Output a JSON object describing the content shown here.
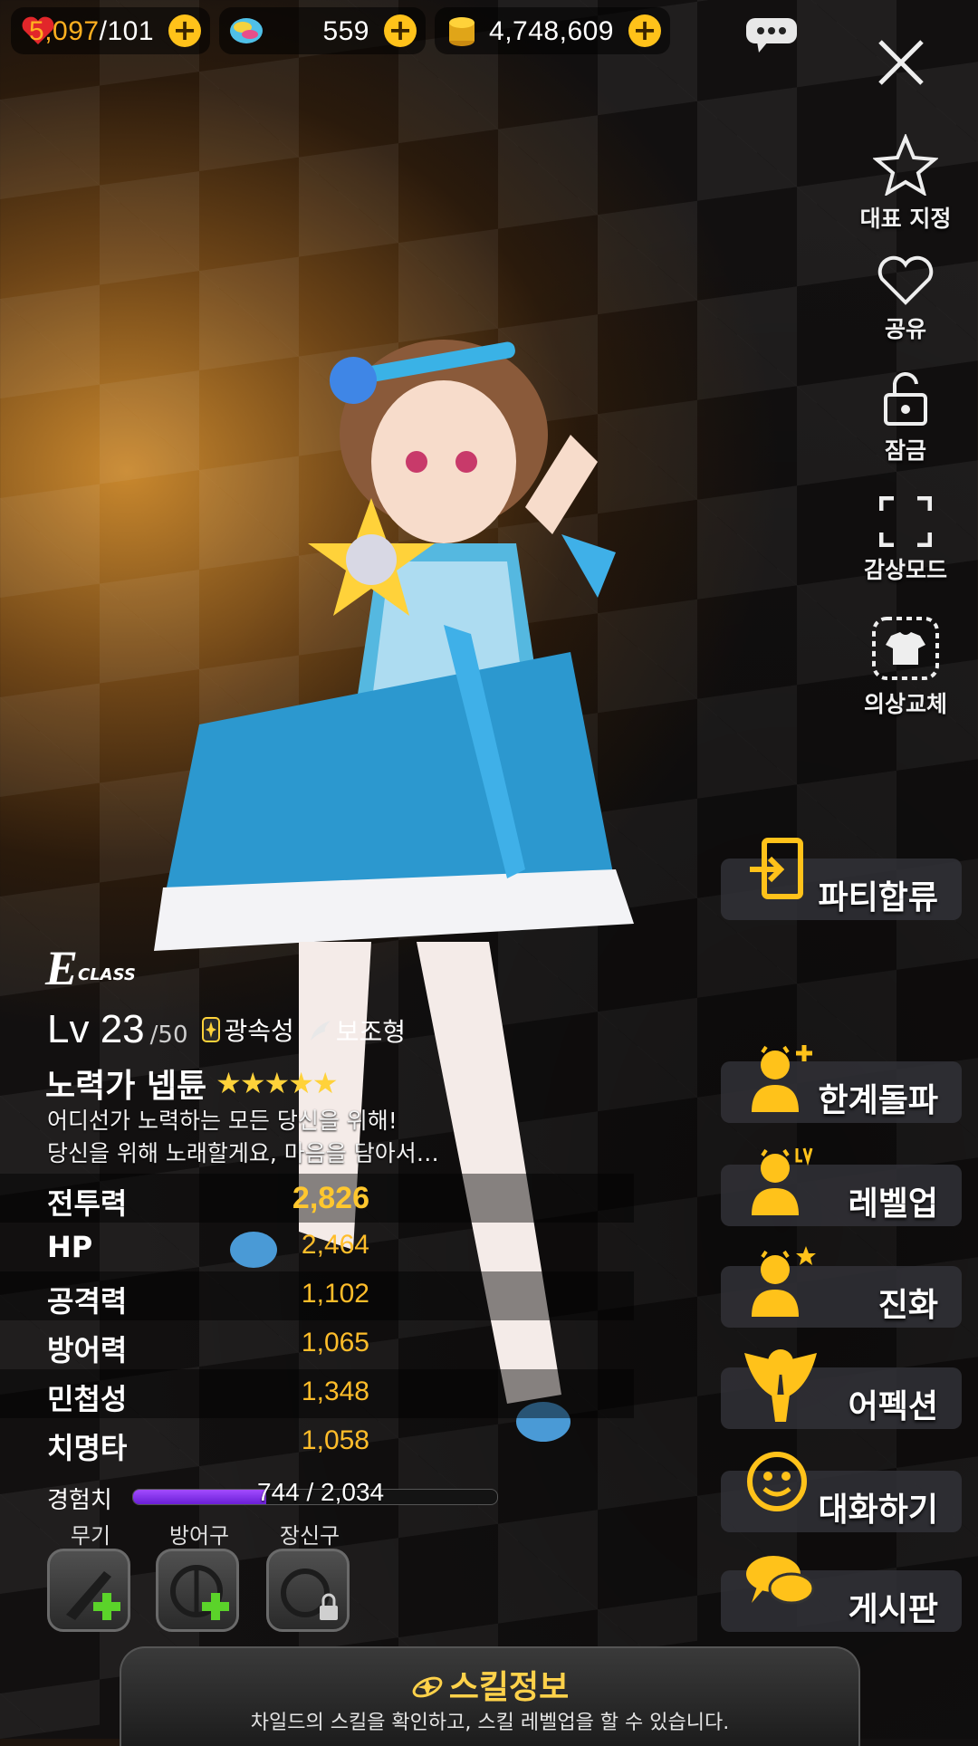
{
  "resources": {
    "hp_current": "5,097",
    "hp_max": "/101",
    "gems": "559",
    "gold": "4,748,609",
    "plus_symbol": "+"
  },
  "side_menu": {
    "representative": "대표 지정",
    "share": "공유",
    "lock": "잠금",
    "view_mode": "감상모드",
    "costume": "의상교체"
  },
  "actions": {
    "party": "파티합류",
    "limit_break": "한계돌파",
    "level_up": "레벨업",
    "evolve": "진화",
    "affection": "어펙션",
    "talk": "대화하기",
    "board": "게시판"
  },
  "character": {
    "class_letter": "E",
    "class_word": "CLASS",
    "level": "Lv 23",
    "level_max": "/50",
    "element": "광속성",
    "role": "보조형",
    "name": "노력가 넵튠",
    "stars": "★★★★★",
    "star_count": 5,
    "desc_line1": "어디선가 노력하는 모든 당신을 위해!",
    "desc_line2": "당신을 위해 노래할게요, 마음을 담아서…"
  },
  "stats": [
    {
      "label": "전투력",
      "value": "2,826"
    },
    {
      "label": "HP",
      "value": "2,464"
    },
    {
      "label": "공격력",
      "value": "1,102"
    },
    {
      "label": "방어력",
      "value": "1,065"
    },
    {
      "label": "민첩성",
      "value": "1,348"
    },
    {
      "label": "치명타",
      "value": "1,058"
    }
  ],
  "exp": {
    "label": "경험치",
    "text": "744 / 2,034",
    "current": 744,
    "max": 2034
  },
  "equipment": {
    "weapon": "무기",
    "armor": "방어구",
    "accessory": "장신구"
  },
  "skill": {
    "title": "스킬정보",
    "subtitle": "차일드의 스킬을 확인하고, 스킬 레벨업을 할 수 있습니다."
  },
  "colors": {
    "accent_gold": "#ffc21a",
    "stat_value": "#ffbd2a",
    "exp_fill": "#8a34f0"
  }
}
